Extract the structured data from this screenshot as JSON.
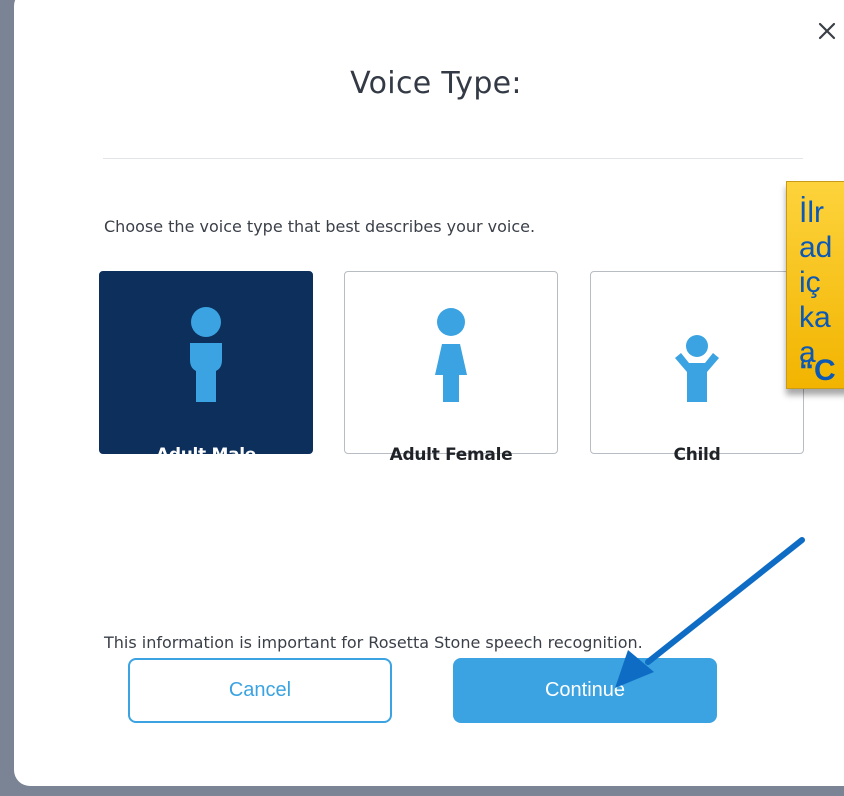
{
  "dialog": {
    "title": "Voice Type:",
    "prompt": "Choose the voice type that best describes your voice.",
    "info": "This information is important for Rosetta Stone speech recognition.",
    "close_icon": "close-icon",
    "options": [
      {
        "label": "Adult Male",
        "icon": "adult-male-icon",
        "selected": true
      },
      {
        "label": "Adult Female",
        "icon": "adult-female-icon",
        "selected": false
      },
      {
        "label": "Child",
        "icon": "child-icon",
        "selected": false
      }
    ],
    "cancel_label": "Cancel",
    "continue_label": "Continue"
  },
  "annotation": {
    "lines": [
      "İlr",
      "ad",
      "iç",
      "ka",
      "a",
      "“C"
    ],
    "arrow_target": "continue-button"
  },
  "colors": {
    "accent": "#3ba3e1",
    "selected": "#0c2f5c",
    "callout": "#f9c21b",
    "callout_text": "#0b58b6",
    "arrow": "#0f6cc5",
    "backdrop": "#7b8494"
  }
}
